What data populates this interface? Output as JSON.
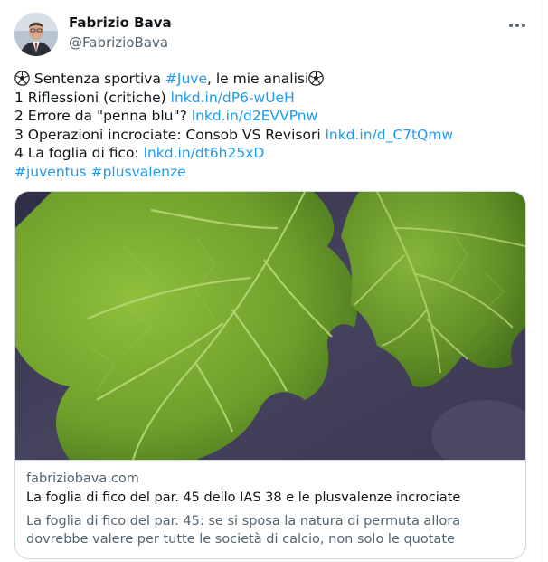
{
  "author": {
    "name": "Fabrizio Bava",
    "handle": "@FabrizioBava",
    "avatar_icon": "profile-photo"
  },
  "more_icon": "more-options-icon",
  "tweet": {
    "line1": {
      "prefix": " Sentenza sportiva ",
      "hashtag": "#Juve",
      "suffix": ", le mie analisi",
      "emoji": "soccer-ball-icon"
    },
    "line2": {
      "text": "1 Riflessioni (critiche) ",
      "link": "lnkd.in/dP6-wUeH"
    },
    "line3": {
      "text": "2 Errore da \"penna blu\"? ",
      "link": "lnkd.in/d2EVVPnw"
    },
    "line4": {
      "text": "3 Operazioni incrociate: Consob VS Revisori ",
      "link": "lnkd.in/d_C7tQmw"
    },
    "line5": {
      "text": "4 La foglia di fico: ",
      "link": "lnkd.in/dt6h25xD"
    },
    "hashtags": [
      "#juventus",
      "#plusvalenze"
    ]
  },
  "link_card": {
    "image": "fig-leaf-photo",
    "domain": "fabriziobava.com",
    "title": "La foglia di fico del par. 45 dello IAS 38 e le plusvalenze incrociate",
    "description": "La foglia di fico del par. 45: se si sposa la natura di permuta allora dovrebbe valere per tutte le società di calcio, non solo le quotate"
  },
  "colors": {
    "link": "#1d9bf0",
    "text": "#0f1419",
    "secondary": "#536471",
    "border": "#cfd9de"
  }
}
